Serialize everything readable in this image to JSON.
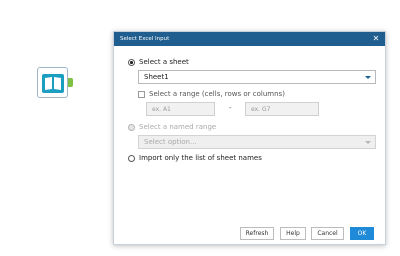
{
  "dialog": {
    "title": "Select Excel Input",
    "close_glyph": "✕",
    "option_sheet": {
      "label": "Select a sheet",
      "checked": true
    },
    "sheet_dropdown": {
      "value": "Sheet1"
    },
    "range": {
      "label": "Select a range (cells, rows or columns)",
      "start_placeholder": "ex. A1",
      "separator": "-",
      "end_placeholder": "ex. G7"
    },
    "option_named_range": {
      "label": "Select a named range",
      "disabled": true
    },
    "named_range_dropdown": {
      "placeholder": "Select option..."
    },
    "option_sheet_names": {
      "label": "Import only the list of sheet names"
    },
    "buttons": {
      "refresh": "Refresh",
      "help": "Help",
      "cancel": "Cancel",
      "ok": "OK"
    }
  },
  "colors": {
    "title_bar": "#1f5e8e",
    "primary_button": "#1f8ad8",
    "tool_accent": "#7dc242",
    "tool_book": "#1a9fc1"
  },
  "canvas": {
    "tool_icon": "input-data-book-icon"
  }
}
